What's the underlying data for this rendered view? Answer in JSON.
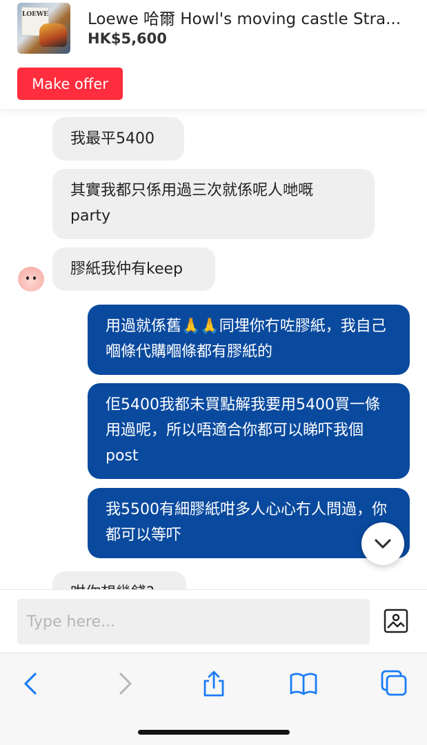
{
  "listing": {
    "thumb_brand": "LOEWE",
    "title": "Loewe 哈爾 Howl's moving castle Stra...",
    "price": "HK$5,600",
    "offer_label": "Make offer"
  },
  "messages": [
    {
      "from": "seller",
      "text": "我最平5400"
    },
    {
      "from": "seller",
      "text": "其實我都只係用過三次就係呢人哋嘅 party"
    },
    {
      "from": "seller",
      "text": "膠紙我仲有keep"
    },
    {
      "from": "buyer",
      "text": "用過就係舊🙏🙏同埋你冇咗膠紙，我自己嗰條代購嗰條都有膠紙的"
    },
    {
      "from": "buyer",
      "text": "佢5400我都未買點解我要用5400買一條用過呢，所以唔適合你都可以睇吓我個post"
    },
    {
      "from": "buyer",
      "text": "我5500有細膠紙咁多人心心冇人問過，你都可以等吓"
    },
    {
      "from": "seller",
      "text": "咁你想幾錢?"
    }
  ],
  "composer": {
    "placeholder": "Type here..."
  },
  "icons": {
    "scroll_down": "chevron-down-icon",
    "photo": "image-icon",
    "back": "chevron-left-icon",
    "forward": "chevron-right-icon",
    "share": "share-icon",
    "bookmarks": "book-icon",
    "tabs": "tabs-icon"
  },
  "colors": {
    "offer_button": "#ff2d3d",
    "outgoing_bubble": "#0a4a9e",
    "incoming_bubble": "#efefef",
    "ios_blue": "#1a7cf5"
  }
}
